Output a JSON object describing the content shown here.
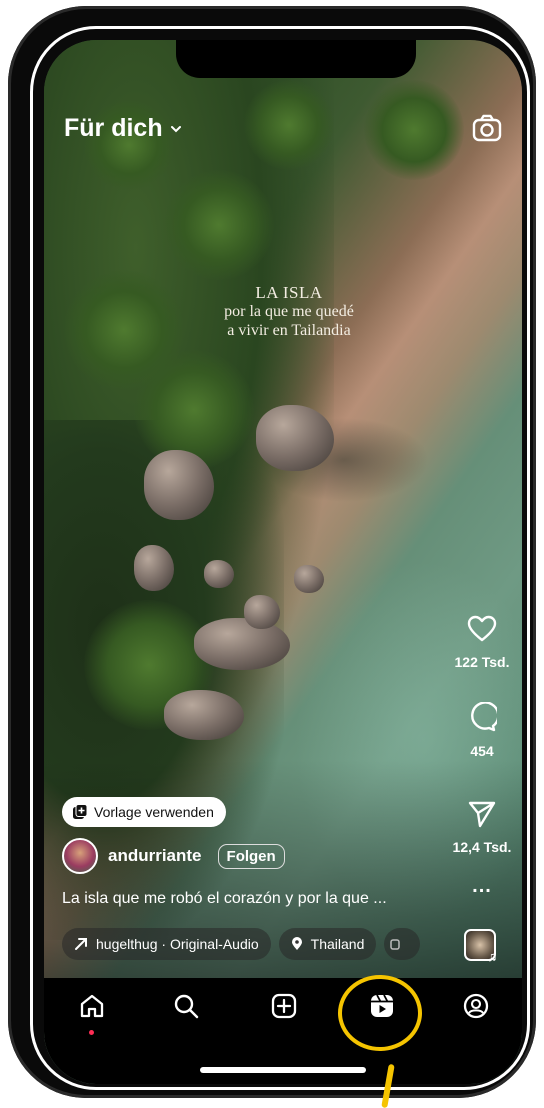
{
  "header": {
    "title": "Für dich"
  },
  "video_overlay": {
    "line1": "LA ISLA",
    "line2": "por la que me quedé",
    "line3": "a vivir en Tailandia"
  },
  "actions": {
    "likes": "122 Tsd.",
    "comments": "454",
    "shares": "12,4 Tsd.",
    "more": "..."
  },
  "template_pill": {
    "label": "Vorlage verwenden"
  },
  "user": {
    "name": "andurriante",
    "follow_label": "Folgen"
  },
  "caption": "La isla que me robó el corazón y por la que ...",
  "chips": {
    "audio": "hugelthug · Original-Audio",
    "location": "Thailand"
  },
  "colors": {
    "highlight": "#f5c400",
    "accent_dot": "#ff2d55"
  },
  "nav": [
    "home-icon",
    "search-icon",
    "create-icon",
    "reels-icon",
    "profile-icon"
  ]
}
